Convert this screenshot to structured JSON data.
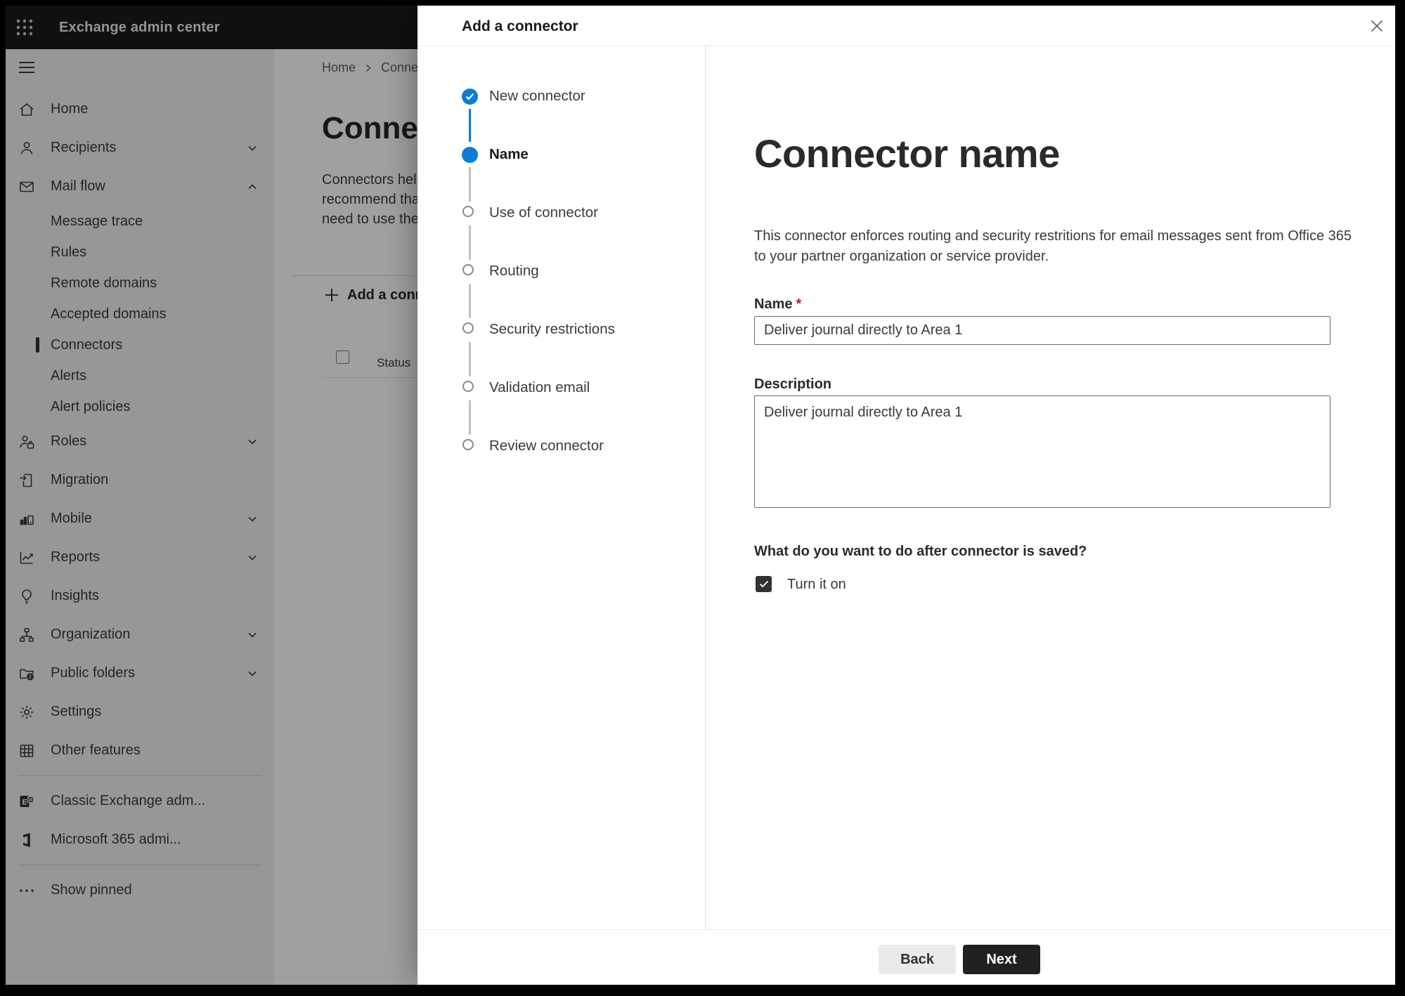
{
  "app": {
    "title": "Exchange admin center"
  },
  "sidebar": {
    "items": [
      {
        "label": "Home",
        "icon": "home",
        "kind": "top",
        "chevron": null,
        "selected": false
      },
      {
        "label": "Recipients",
        "icon": "person",
        "kind": "top",
        "chevron": "down",
        "selected": false
      },
      {
        "label": "Mail flow",
        "icon": "mail",
        "kind": "top",
        "chevron": "up",
        "selected": false
      },
      {
        "label": "Message trace",
        "icon": null,
        "kind": "sub",
        "chevron": null,
        "selected": false
      },
      {
        "label": "Rules",
        "icon": null,
        "kind": "sub",
        "chevron": null,
        "selected": false
      },
      {
        "label": "Remote domains",
        "icon": null,
        "kind": "sub",
        "chevron": null,
        "selected": false
      },
      {
        "label": "Accepted domains",
        "icon": null,
        "kind": "sub",
        "chevron": null,
        "selected": false
      },
      {
        "label": "Connectors",
        "icon": null,
        "kind": "sub",
        "chevron": null,
        "selected": true
      },
      {
        "label": "Alerts",
        "icon": null,
        "kind": "sub",
        "chevron": null,
        "selected": false
      },
      {
        "label": "Alert policies",
        "icon": null,
        "kind": "sub",
        "chevron": null,
        "selected": false
      },
      {
        "label": "Roles",
        "icon": "roles",
        "kind": "top",
        "chevron": "down",
        "selected": false
      },
      {
        "label": "Migration",
        "icon": "migration",
        "kind": "top",
        "chevron": null,
        "selected": false
      },
      {
        "label": "Mobile",
        "icon": "mobile",
        "kind": "top",
        "chevron": "down",
        "selected": false
      },
      {
        "label": "Reports",
        "icon": "reports",
        "kind": "top",
        "chevron": "down",
        "selected": false
      },
      {
        "label": "Insights",
        "icon": "insights",
        "kind": "top",
        "chevron": null,
        "selected": false
      },
      {
        "label": "Organization",
        "icon": "organization",
        "kind": "top",
        "chevron": "down",
        "selected": false
      },
      {
        "label": "Public folders",
        "icon": "public-folders",
        "kind": "top",
        "chevron": "down",
        "selected": false
      },
      {
        "label": "Settings",
        "icon": "settings",
        "kind": "top",
        "chevron": null,
        "selected": false
      },
      {
        "label": "Other features",
        "icon": "other-features",
        "kind": "top",
        "chevron": null,
        "selected": false
      },
      {
        "label": "Classic Exchange adm...",
        "icon": "classic-exchange",
        "kind": "top",
        "chevron": null,
        "selected": false
      },
      {
        "label": "Microsoft 365 admi...",
        "icon": "m365",
        "kind": "top",
        "chevron": null,
        "selected": false
      },
      {
        "label": "Show pinned",
        "icon": "show-pinned",
        "kind": "top",
        "chevron": null,
        "selected": false
      }
    ]
  },
  "page": {
    "breadcrumb": {
      "home": "Home",
      "current": "Conne"
    },
    "heading": "Connec",
    "paragraph_lines": [
      "Connectors help",
      "recommend tha",
      "need to use ther"
    ],
    "add_button_label": "Add a conn",
    "table": {
      "status_header": "Status"
    }
  },
  "modal": {
    "title": "Add a connector",
    "steps": [
      {
        "label": "New connector",
        "state": "done"
      },
      {
        "label": "Name",
        "state": "active"
      },
      {
        "label": "Use of connector",
        "state": "todo"
      },
      {
        "label": "Routing",
        "state": "todo"
      },
      {
        "label": "Security restrictions",
        "state": "todo"
      },
      {
        "label": "Validation email",
        "state": "todo"
      },
      {
        "label": "Review connector",
        "state": "todo"
      }
    ],
    "content": {
      "heading": "Connector name",
      "description_lines": {
        "line1": "This connector enforces routing and security restritions for email messages sent from Office 365",
        "line2": "to your partner organization or service provider."
      },
      "name_label": "Name",
      "required_marker": "*",
      "name_value": "Deliver journal directly to Area 1",
      "description_label": "Description",
      "description_value": "Deliver journal directly to Area 1",
      "after_save_question": "What do you want to do after connector is saved?",
      "turn_on_label": "Turn it on",
      "turn_on_checked": true
    },
    "footer": {
      "back_label": "Back",
      "next_label": "Next"
    }
  },
  "colors": {
    "accent_blue": "#0b7cd8",
    "required_red": "#a4262c",
    "next_button_bg": "#222120",
    "back_button_bg": "#ebeae9",
    "topbar_bg": "#1a1a19",
    "sidebar_bg": "#ededec"
  }
}
